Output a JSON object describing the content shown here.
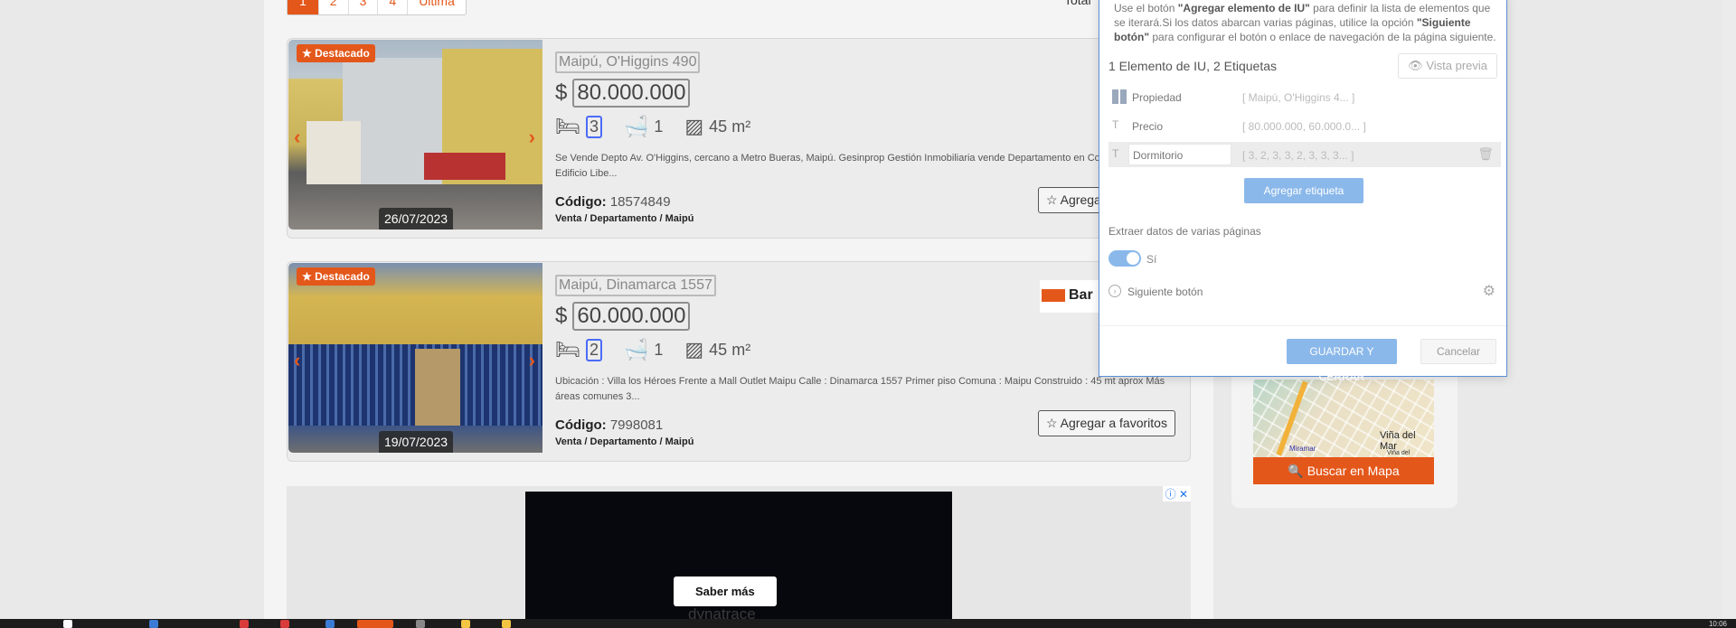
{
  "pagination": {
    "pages": [
      "1",
      "2",
      "3",
      "4"
    ],
    "last_label": "Última",
    "total_label": "Total"
  },
  "listings": [
    {
      "badge": "Destacado",
      "date": "26/07/2023",
      "address": "Maipú, O'Higgins 490",
      "currency": "$",
      "price": "80.000.000",
      "bedrooms": "3",
      "bathrooms": "1",
      "area": "45 m²",
      "description": "Se Vende Depto Av. O'Higgins, cercano a Metro Bueras, Maipú. Gesinprop Gestión Inmobiliaria vende Departamento en Condominio Edificio Libe...",
      "code_label": "Código:",
      "code": "18574849",
      "breadcrumb": "Venta / Departamento / Maipú",
      "favorite_label": "Agregar a favoritos"
    },
    {
      "badge": "Destacado",
      "date": "19/07/2023",
      "address": "Maipú, Dinamarca 1557",
      "currency": "$",
      "price": "60.000.000",
      "bedrooms": "2",
      "bathrooms": "1",
      "area": "45 m²",
      "description": "Ubicación : Villa los Héroes Frente a Mall Outlet Maipu Calle : Dinamarca 1557 Primer piso Comuna : Maipu Construido : 45 mt aprox Más áreas comunes 3...",
      "code_label": "Código:",
      "code": "7998081",
      "breadcrumb": "Venta / Departamento / Maipú",
      "favorite_label": "Agregar a favoritos",
      "agency_logo_text": "Bar"
    }
  ],
  "ad": {
    "button_label": "Saber más",
    "brand": "dynatrace"
  },
  "map": {
    "city_label": "Viña del Mar",
    "area_label": "Miramar",
    "small_label": "Viña del",
    "button_label": "Buscar en Mapa"
  },
  "dialog": {
    "help_pre": "Use el botón ",
    "help_bold1": "\"Agregar elemento de IU\"",
    "help_mid": " para definir la lista de elementos que se iterará.Si los datos abarcan varias páginas, utilice la opción ",
    "help_bold2": "\"Siguiente botón\"",
    "help_post": " para configurar el botón o enlace de navegación de la página siguiente.",
    "summary": "1 Elemento de IU, 2 Etiquetas",
    "preview_label": "Vista previa",
    "fields": [
      {
        "name": "Propiedad",
        "value": "[ Maipú, O'Higgins 4... ]"
      },
      {
        "name": "Precio",
        "value": "[ 80.000.000, 60.000.0... ]"
      },
      {
        "name": "Dormitorio",
        "value": "[ 3, 2, 3, 3, 2, 3, 3, 3... ]"
      }
    ],
    "add_tag_label": "Agregar etiqueta",
    "multi_page_label": "Extraer datos de varias páginas",
    "toggle_label": "Sí",
    "next_button_label": "Siguiente botón",
    "save_label": "GUARDAR Y CERRAR",
    "cancel_label": "Cancelar"
  },
  "taskbar": {
    "clock": "10:06"
  },
  "colors": {
    "accent": "#e4571a",
    "dialog_blue": "#8ab8ea",
    "dialog_border": "#5b8fd6"
  }
}
